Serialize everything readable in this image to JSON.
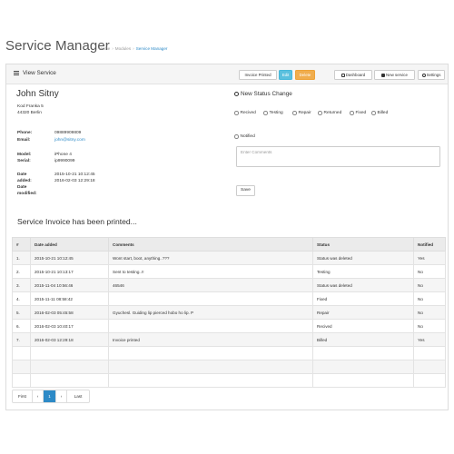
{
  "header": {
    "title": "Service Manager",
    "breadcrumb": [
      "Home",
      "Modules",
      "Service Manager"
    ]
  },
  "panel": {
    "title": "View Service",
    "buttons": {
      "invoice": "Invoice Printed",
      "edit": "Edit",
      "delete": "Delete",
      "dashboard": "Dashboard",
      "new_service": "New service",
      "settings": "Settings"
    }
  },
  "customer": {
    "name": "John Sitny",
    "address_line1": "Kod Franka 5",
    "address_line2": "44320 Berlin",
    "phone_label": "Phone:",
    "phone": "09889909809",
    "email_label": "Email:",
    "email": "john@sitny.com",
    "model_label": "Model:",
    "model": "iPhone 4",
    "serial_label": "Serial:",
    "serial": "ip9990099",
    "date_added_label_1": "Date",
    "date_added_label_2": "added:",
    "date_added": "2015-10-21 10:12:45",
    "date_modified_label_1": "Date",
    "date_modified_label_2": "modified:",
    "date_modified": "2016-02-03 12:29:18"
  },
  "status_form": {
    "title": "New Status Change",
    "options": [
      "Recived",
      "Testing",
      "Repair",
      "Returned",
      "Fixed",
      "Billed"
    ],
    "notified_label": "Notified",
    "comments_placeholder": "Enter Comments",
    "save_label": "Save"
  },
  "printed_message": "Service Invoice has been printed...",
  "table": {
    "headers": [
      "#",
      "Date added",
      "Comments",
      "Status",
      "Notified"
    ],
    "rows": [
      [
        "1.",
        "2015-10-21 10:12:45",
        "Wont start, boot, anything..???",
        "Status was deleted",
        "Yes"
      ],
      [
        "2.",
        "2015-10-21 10:13:17",
        "Sent to testing..!!",
        "Testing",
        "No"
      ],
      [
        "3.",
        "2015-11-04 10:56:46",
        "46546",
        "Status was deleted",
        "No"
      ],
      [
        "4.",
        "2015-11-11 08:58:42",
        "",
        "Fixed",
        "No"
      ],
      [
        "5.",
        "2016-02-03 05:45:58",
        "Gyuchesl. Guiding lip pierced hobo ho lip. P",
        "Repair",
        "No"
      ],
      [
        "6.",
        "2016-02-03 10:40:17",
        "",
        "Recived",
        "No"
      ],
      [
        "7.",
        "2016-02-03 12:29:18",
        "Invoice printed",
        "Billed",
        "Yes"
      ],
      [
        "",
        "",
        "",
        "",
        ""
      ],
      [
        "",
        "",
        "",
        "",
        ""
      ],
      [
        "",
        "",
        "",
        "",
        ""
      ]
    ]
  },
  "pagination": {
    "first": "First",
    "prev": "‹",
    "current": "1",
    "next": "›",
    "last": "Last"
  }
}
